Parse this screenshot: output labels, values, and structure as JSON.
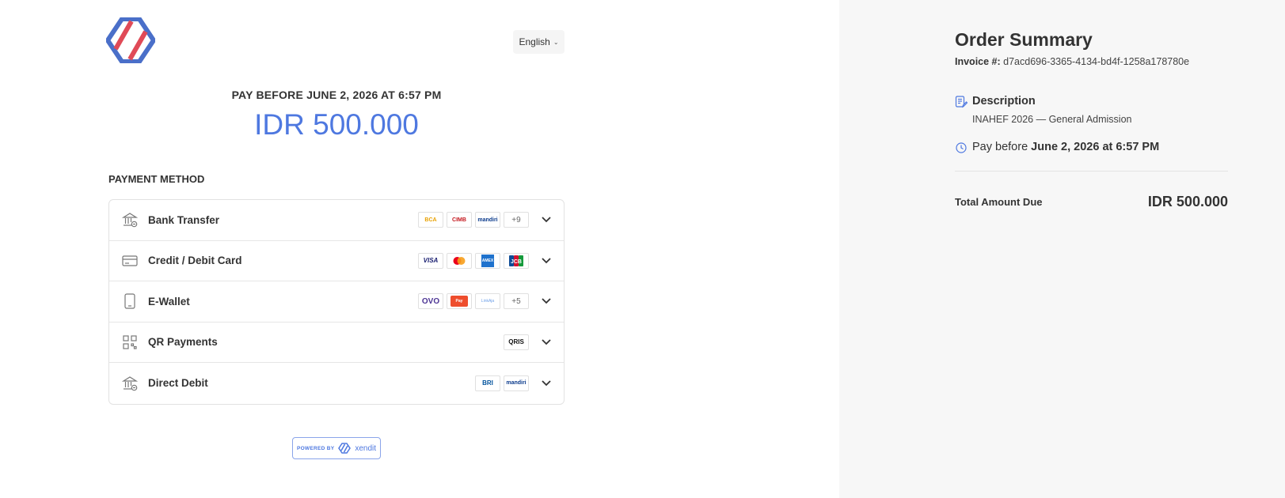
{
  "header": {
    "language": "English"
  },
  "payment": {
    "pay_before_banner": "PAY BEFORE JUNE 2, 2026 AT 6:57 PM",
    "amount": "IDR 500.000",
    "method_heading": "PAYMENT METHOD",
    "methods": [
      {
        "label": "Bank Transfer",
        "icon": "bank-icon",
        "logos": [
          "BCA",
          "CIMB",
          "mandiri"
        ],
        "more": "+9"
      },
      {
        "label": "Credit / Debit Card",
        "icon": "card-icon",
        "logos": [
          "VISA",
          "Mastercard",
          "AMEX",
          "JCB"
        ],
        "more": ""
      },
      {
        "label": "E-Wallet",
        "icon": "phone-icon",
        "logos": [
          "OVO",
          "ShopeePay",
          "LinkAja"
        ],
        "more": "+5"
      },
      {
        "label": "QR Payments",
        "icon": "qr-icon",
        "logos": [
          "QRIS"
        ],
        "more": ""
      },
      {
        "label": "Direct Debit",
        "icon": "bank-icon",
        "logos": [
          "BRI",
          "mandiri"
        ],
        "more": ""
      }
    ],
    "powered_by": "POWERED BY",
    "powered_brand": "xendit"
  },
  "order_summary": {
    "title": "Order Summary",
    "invoice_label": "Invoice #:",
    "invoice_id": "d7acd696-3365-4134-bd4f-1258a178780e",
    "description_label": "Description",
    "description_text": "INAHEF 2026 — General Admission",
    "pay_before_prefix": "Pay before",
    "pay_before_date": "June 2, 2026 at 6:57 PM",
    "total_label": "Total Amount Due",
    "total_amount": "IDR 500.000"
  },
  "colors": {
    "accent": "#4e78e0",
    "logo_red": "#e04a57",
    "logo_blue": "#4a6fc9",
    "summary_bg": "#f7f7f7"
  }
}
